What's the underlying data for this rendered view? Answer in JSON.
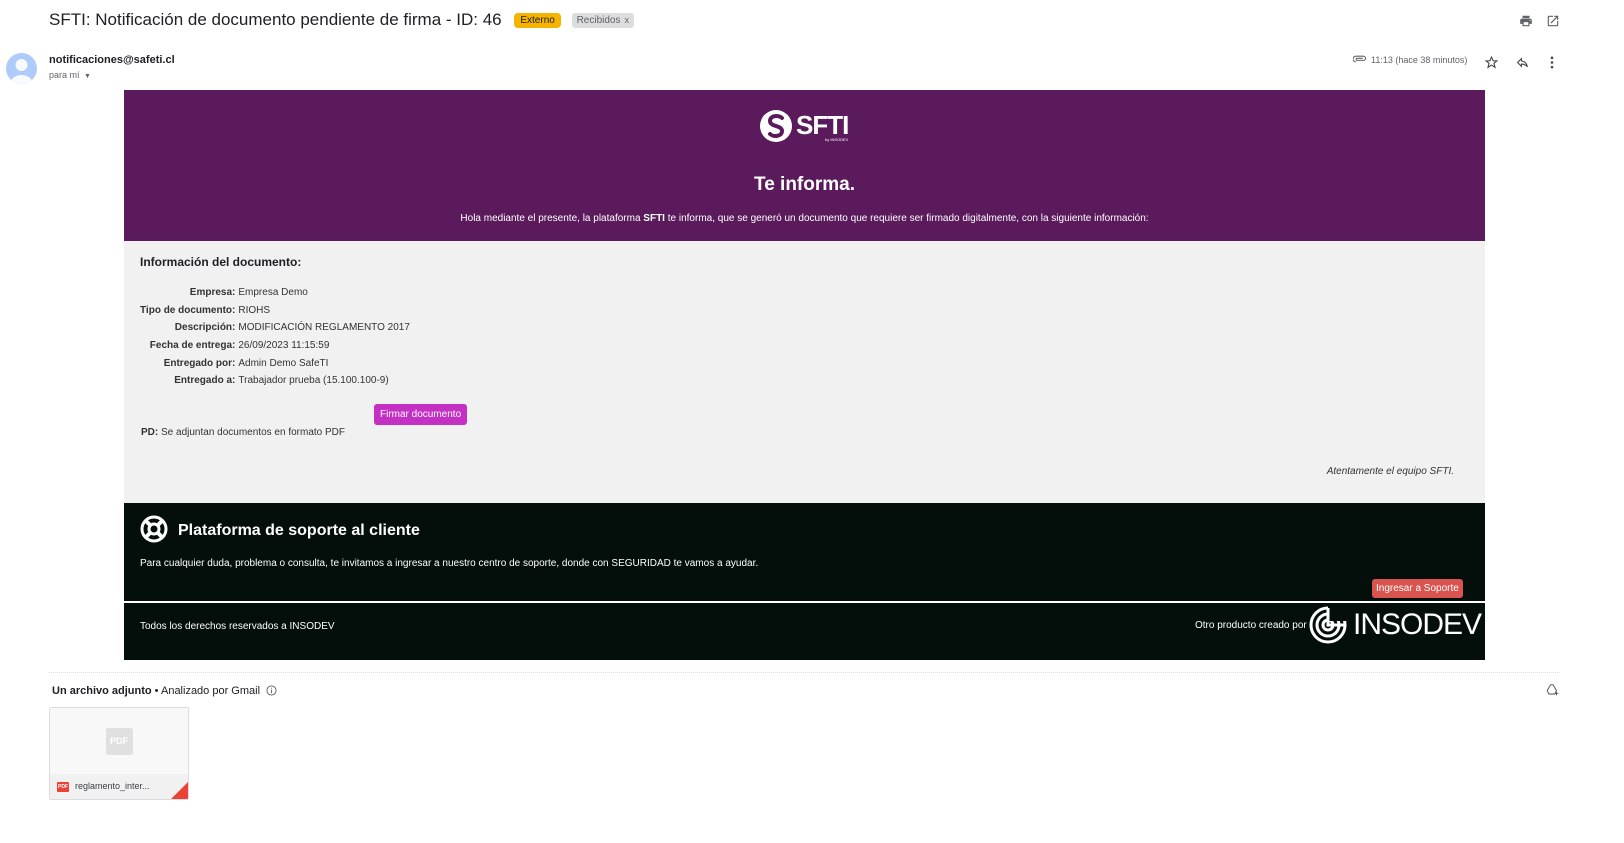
{
  "email": {
    "subject": "SFTI: Notificación de documento pendiente de firma - ID: 46",
    "labels": {
      "external": "Externo",
      "inbox": "Recibidos",
      "inbox_remove": "x"
    },
    "sender": "notificaciones@safeti.cl",
    "to": "para mí",
    "time": "11:13 (hace 38 minutos)"
  },
  "header": {
    "logo_text": "SFTI",
    "logo_sub": "by INSODEV",
    "title": "Te informa.",
    "intro_pre": "Hola mediante el presente, la plataforma ",
    "intro_brand": "SFTI",
    "intro_post": " te informa, que se generó un documento que requiere ser firmado digitalmente, con la siguiente información:"
  },
  "document": {
    "section_title": "Información del documento:",
    "fields": [
      {
        "label": "Empresa:",
        "value": "Empresa Demo"
      },
      {
        "label": "Tipo de documento:",
        "value": "RIOHS"
      },
      {
        "label": "Descripción:",
        "value": "MODIFICACIÓN REGLAMENTO 2017"
      },
      {
        "label": "Fecha de entrega:",
        "value": "26/09/2023 11:15:59"
      },
      {
        "label": "Entregado por:",
        "value": "Admin Demo SafeTI"
      },
      {
        "label": "Entregado a:",
        "value": "Trabajador prueba (15.100.100-9)"
      }
    ],
    "sign_button": "Firmar documento",
    "pd_label": "PD:",
    "pd_text": " Se adjuntan documentos en formato PDF",
    "sign_off": "Atentamente el equipo SFTI."
  },
  "support": {
    "title": "Plataforma de soporte al cliente",
    "text": "Para cualquier duda, problema o consulta, te invitamos a ingresar a nuestro centro de soporte, donde con SEGURIDAD te vamos a ayudar.",
    "button": "Ingresar a Soporte"
  },
  "footer": {
    "rights": "Todos los derechos reservados a INSODEV",
    "by": "Otro producto creado por",
    "brand": "INSODEV"
  },
  "attachments": {
    "title": "Un archivo adjunto",
    "sep": " • ",
    "scanned": "Analizado por Gmail",
    "files": [
      {
        "type": "PDF",
        "name": "reglamento_inter..."
      }
    ]
  },
  "colors": {
    "header_purple": "#5a1a5c",
    "sign_button": "#c42fc4",
    "support_button": "#d9534f",
    "footer_black": "#040f0b",
    "external_chip": "#f4b400"
  }
}
